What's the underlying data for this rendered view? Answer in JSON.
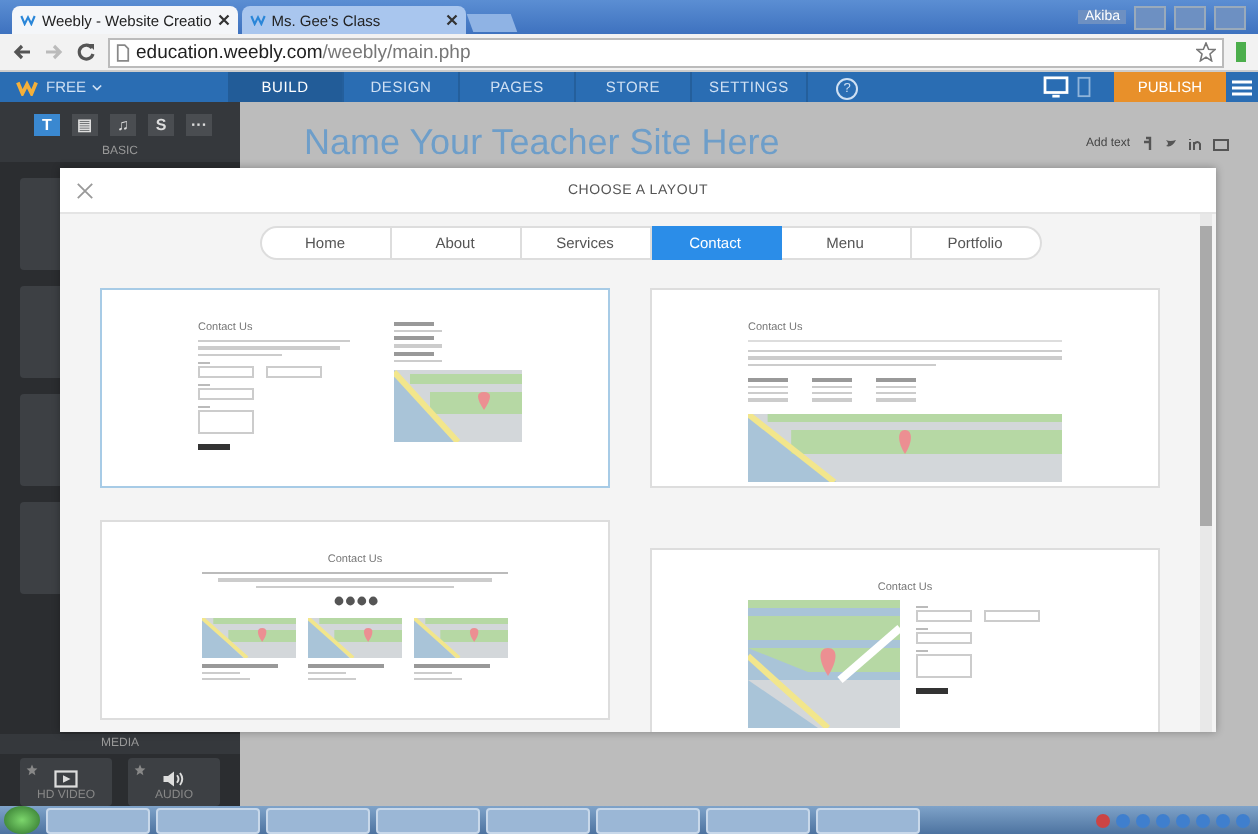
{
  "browser": {
    "tabs": [
      {
        "label": "Weebly - Website Creatio",
        "selected": true
      },
      {
        "label": "Ms. Gee's Class",
        "selected": false
      }
    ],
    "user": "Akiba",
    "url_host": "education.weebly.com",
    "url_path": "/weebly/main.php"
  },
  "editor": {
    "plan": "FREE",
    "nav": [
      {
        "label": "BUILD",
        "selected": true
      },
      {
        "label": "DESIGN",
        "selected": false
      },
      {
        "label": "PAGES",
        "selected": false
      },
      {
        "label": "STORE",
        "selected": false
      },
      {
        "label": "SETTINGS",
        "selected": false
      }
    ],
    "help": "?",
    "publish": "PUBLISH"
  },
  "sidebar": {
    "tools": [
      {
        "glyph": "T",
        "selected": true
      },
      {
        "glyph": "▤",
        "selected": false
      },
      {
        "glyph": "♫",
        "selected": false
      },
      {
        "glyph": "S",
        "selected": false
      },
      {
        "glyph": "···",
        "selected": false
      }
    ],
    "section": "BASIC",
    "media_section": "MEDIA",
    "media": [
      {
        "label": "HD VIDEO",
        "kind": "video"
      },
      {
        "label": "AUDIO",
        "kind": "audio"
      }
    ]
  },
  "site": {
    "title": "Name Your Teacher Site Here",
    "add_text": "Add text"
  },
  "modal": {
    "title": "CHOOSE A LAYOUT",
    "tabs": [
      {
        "label": "Home",
        "selected": false
      },
      {
        "label": "About",
        "selected": false
      },
      {
        "label": "Services",
        "selected": false
      },
      {
        "label": "Contact",
        "selected": true
      },
      {
        "label": "Menu",
        "selected": false
      },
      {
        "label": "Portfolio",
        "selected": false
      }
    ],
    "layouts": [
      {
        "kind": "form-map",
        "heading": "Contact Us",
        "selected": true
      },
      {
        "kind": "wide-map",
        "heading": "Contact Us",
        "selected": false
      },
      {
        "kind": "three-maps",
        "heading": "Contact Us",
        "selected": false
      },
      {
        "kind": "map-form",
        "heading": "Contact Us",
        "selected": false
      }
    ]
  }
}
